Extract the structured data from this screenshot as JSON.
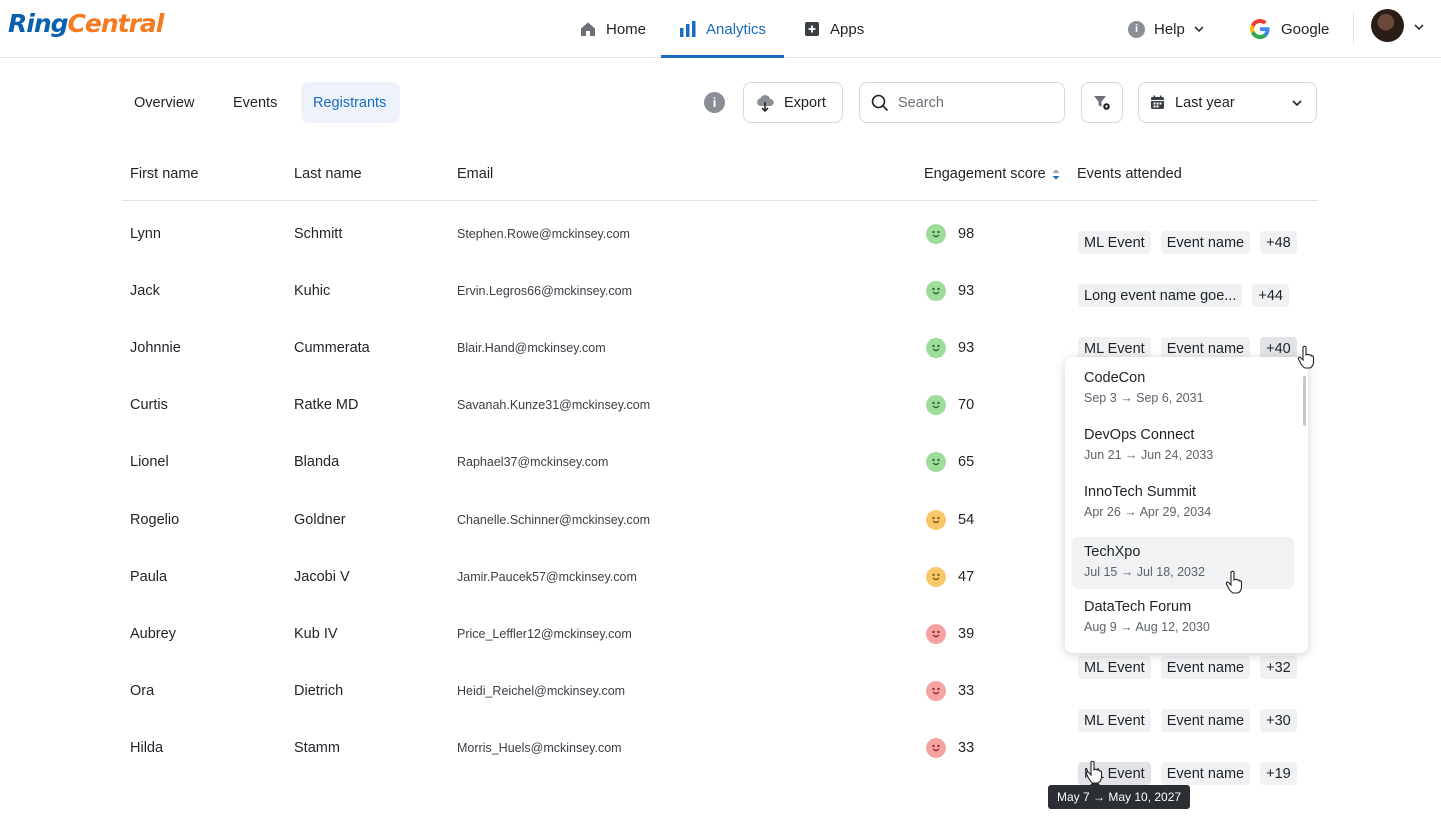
{
  "brand": {
    "part1": "Ring",
    "part2": "Central",
    "primary_color": "#0a5fae",
    "accent_color": "#f47b20"
  },
  "nav": {
    "items": [
      {
        "label": "Home",
        "icon": "home-icon",
        "active": false
      },
      {
        "label": "Analytics",
        "icon": "bar-chart-icon",
        "active": true
      },
      {
        "label": "Apps",
        "icon": "plus-square-icon",
        "active": false
      }
    ],
    "help_label": "Help",
    "account_label": "Google",
    "active_color": "#1b6bbf"
  },
  "tabs": [
    {
      "label": "Overview",
      "active": false
    },
    {
      "label": "Events",
      "active": false
    },
    {
      "label": "Registrants",
      "active": true
    }
  ],
  "toolbar": {
    "export_label": "Export",
    "search_placeholder": "Search",
    "date_range": "Last year"
  },
  "table": {
    "columns": [
      "First name",
      "Last name",
      "Email",
      "Engagement score",
      "Events attended"
    ],
    "rows": [
      {
        "first": "Lynn",
        "last": "Schmitt",
        "email": "Stephen.Rowe@mckinsey.com",
        "score": "98",
        "sentiment": "high",
        "events": [
          "ML Event",
          "Event name"
        ],
        "more": "+48"
      },
      {
        "first": "Jack",
        "last": "Kuhic",
        "email": "Ervin.Legros66@mckinsey.com",
        "score": "93",
        "sentiment": "high",
        "events": [
          "Long event name goe..."
        ],
        "more": "+44"
      },
      {
        "first": "Johnnie",
        "last": "Cummerata",
        "email": "Blair.Hand@mckinsey.com",
        "score": "93",
        "sentiment": "high",
        "events": [
          "ML Event",
          "Event name"
        ],
        "more": "+40"
      },
      {
        "first": "Curtis",
        "last": "Ratke MD",
        "email": "Savanah.Kunze31@mckinsey.com",
        "score": "70",
        "sentiment": "high",
        "events": [],
        "more": ""
      },
      {
        "first": "Lionel",
        "last": "Blanda",
        "email": "Raphael37@mckinsey.com",
        "score": "65",
        "sentiment": "high",
        "events": [],
        "more": ""
      },
      {
        "first": "Rogelio",
        "last": "Goldner",
        "email": "Chanelle.Schinner@mckinsey.com",
        "score": "54",
        "sentiment": "medium",
        "events": [],
        "more": ""
      },
      {
        "first": "Paula",
        "last": "Jacobi V",
        "email": "Jamir.Paucek57@mckinsey.com",
        "score": "47",
        "sentiment": "medium",
        "events": [],
        "more": ""
      },
      {
        "first": "Aubrey",
        "last": "Kub IV",
        "email": "Price_Leffler12@mckinsey.com",
        "score": "39",
        "sentiment": "low",
        "events": [
          "ML Event",
          "Event name"
        ],
        "more": "+32"
      },
      {
        "first": "Ora",
        "last": "Dietrich",
        "email": "Heidi_Reichel@mckinsey.com",
        "score": "33",
        "sentiment": "low",
        "events": [
          "ML Event",
          "Event name"
        ],
        "more": "+30"
      },
      {
        "first": "Hilda",
        "last": "Stamm",
        "email": "Morris_Huels@mckinsey.com",
        "score": "33",
        "sentiment": "low",
        "events": [
          "ML Event",
          "Event name"
        ],
        "more": "+19"
      }
    ]
  },
  "dropdown": {
    "items": [
      {
        "name": "CodeCon",
        "dates": "Sep 3 → Sep 6, 2031"
      },
      {
        "name": "DevOps Connect",
        "dates": "Jun 21 → Jun 24, 2033"
      },
      {
        "name": "InnoTech Summit",
        "dates": "Apr 26 → Apr 29, 2034"
      },
      {
        "name": "TechXpo",
        "dates": "Jul 15 → Jul 18, 2032"
      },
      {
        "name": "DataTech Forum",
        "dates": "Aug 9 → Aug 12, 2030"
      }
    ]
  },
  "tooltip": {
    "text": "May 7 → May 10, 2027"
  },
  "sentiment_colors": {
    "high": "#9ddc9a",
    "medium": "#f7c86a",
    "low": "#f5a3a3"
  }
}
